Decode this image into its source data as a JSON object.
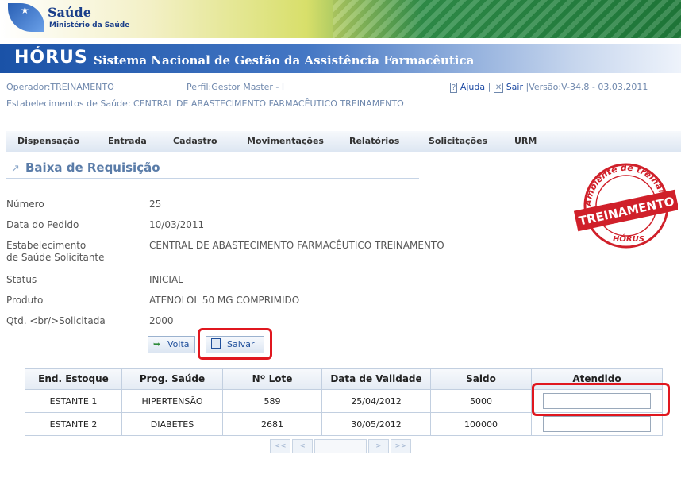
{
  "header": {
    "logo_saude": "Saúde",
    "logo_ministerio": "Ministério da Saúde",
    "app_name": "HÓRUS",
    "system_title": "Sistema Nacional de Gestão da Assistência Farmacêutica"
  },
  "session": {
    "operador": "Operador:TREINAMENTO",
    "perfil": "Perfil:Gestor Master - I",
    "ajuda": "Ajuda",
    "sair": "Sair",
    "versao": "|Versão:V-34.8 - 03.03.2011",
    "estabelecimento": "Estabelecimentos de Saúde: CENTRAL DE ABASTECIMENTO FARMACÊUTICO TREINAMENTO"
  },
  "menu": [
    "Dispensação",
    "Entrada",
    "Cadastro",
    "Movimentações",
    "Relatórios",
    "Solicitações",
    "URM"
  ],
  "page": {
    "title": "Baixa de Requisição"
  },
  "stamp": {
    "top": "Ambiente de treinamento",
    "main": "TREINAMENTO",
    "bottom": "HÓRUS"
  },
  "form": {
    "numero_label": "Número",
    "numero": "25",
    "data_label": "Data do Pedido",
    "data": "10/03/2011",
    "estab_label_1": "Estabelecimento",
    "estab_label_2": "de Saúde Solicitante",
    "estab": "CENTRAL DE ABASTECIMENTO FARMACÊUTICO TREINAMENTO",
    "status_label": "Status",
    "status": "INICIAL",
    "produto_label": "Produto",
    "produto": "ATENOLOL 50 MG COMPRIMIDO",
    "qtd_label": "Qtd. <br/>Solicitada",
    "qtd": "2000"
  },
  "buttons": {
    "voltar": "Volta",
    "salvar": "Salvar"
  },
  "table": {
    "headers": [
      "End. Estoque",
      "Prog. Saúde",
      "Nº Lote",
      "Data de Validade",
      "Saldo",
      "Atendido"
    ],
    "rows": [
      [
        "ESTANTE 1",
        "HIPERTENSÃO",
        "589",
        "25/04/2012",
        "5000",
        ""
      ],
      [
        "ESTANTE 2",
        "DIABETES",
        "2681",
        "30/05/2012",
        "100000",
        ""
      ]
    ]
  },
  "pager": {
    "first": "<<",
    "prev": "<",
    "next": ">",
    "last": ">>"
  },
  "colors": {
    "highlight": "#e0171f",
    "title_blue": "#1a52a7",
    "link": "#1d4aa3"
  }
}
